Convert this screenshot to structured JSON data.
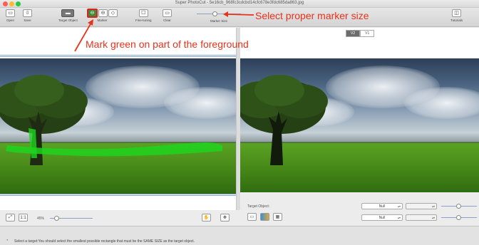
{
  "window": {
    "title": "Super PhotoCut - 5e16cb_968fc3cdcbd14cfc678e3fdc685da863.jpg"
  },
  "toolbar": {
    "items": [
      {
        "label": "Open",
        "icon": "folder-icon"
      },
      {
        "label": "Save",
        "icon": "download-icon"
      },
      {
        "label": "Target Object",
        "icon": "target-object-icon"
      },
      {
        "label": "Marker",
        "icon": "marker-icon"
      },
      {
        "label": "Fine-tuning",
        "icon": "fine-tuning-icon"
      },
      {
        "label": "Clear",
        "icon": "clear-icon"
      },
      {
        "label": "Marker Size",
        "icon": "marker-size-slider"
      },
      {
        "label": "Tutorials",
        "icon": "book-icon"
      }
    ],
    "marker_size_level": 0.4
  },
  "annotations": {
    "marker_size_hint": "Select proper marker size",
    "foreground_hint": "Mark green on part of the foreground",
    "color": "#e8321c"
  },
  "right_pane": {
    "segment": {
      "options": [
        "V2",
        "V1"
      ],
      "selected": "V2"
    }
  },
  "left_controls": {
    "zoom_label": "45%",
    "zoom_level": 0.1
  },
  "right_controls": {
    "target_object_label": "Target Object:",
    "select1": "Null",
    "select2": "Null"
  },
  "status": {
    "text": "Select a target:You should select the smallest possible rectangle that must be the SAME SIZE as the target object."
  },
  "colors": {
    "marker_green": "#1ed41e",
    "accent": "#e8321c"
  }
}
